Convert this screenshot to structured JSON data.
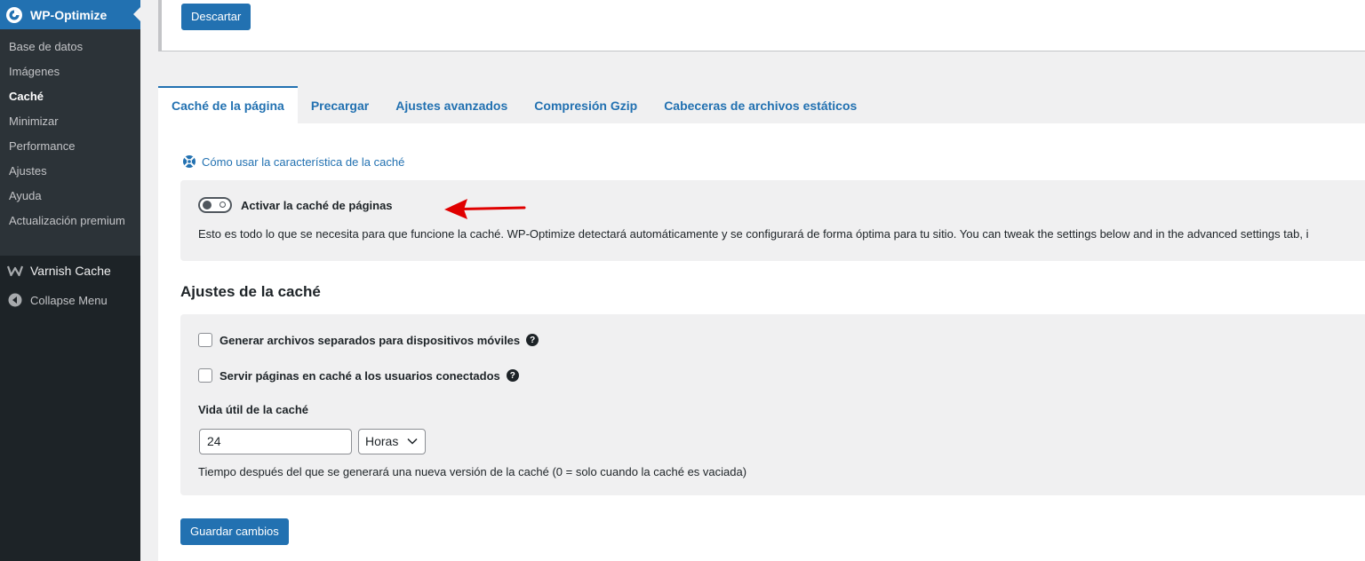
{
  "sidebar": {
    "plugin_title": "WP-Optimize",
    "items": [
      {
        "label": "Base de datos",
        "current": false
      },
      {
        "label": "Imágenes",
        "current": false
      },
      {
        "label": "Caché",
        "current": true
      },
      {
        "label": "Minimizar",
        "current": false
      },
      {
        "label": "Performance",
        "current": false
      },
      {
        "label": "Ajustes",
        "current": false
      },
      {
        "label": "Ayuda",
        "current": false
      },
      {
        "label": "Actualización premium",
        "current": false
      }
    ],
    "varnish_label": "Varnish Cache",
    "collapse_label": "Collapse Menu"
  },
  "top_panel": {
    "dismiss_label": "Descartar"
  },
  "tabs": [
    {
      "label": "Caché de la página",
      "active": true
    },
    {
      "label": "Precargar",
      "active": false
    },
    {
      "label": "Ajustes avanzados",
      "active": false
    },
    {
      "label": "Compresión Gzip",
      "active": false
    },
    {
      "label": "Cabeceras de archivos estáticos",
      "active": false
    }
  ],
  "help_link": "Cómo usar la característica de la caché",
  "page_cache": {
    "toggle_label": "Activar la caché de páginas",
    "toggle_on": false,
    "description": "Esto es todo lo que se necesita para que funcione la caché. WP-Optimize detectará automáticamente y se configurará de forma óptima para tu sitio. You can tweak the settings below and in the advanced settings tab, i"
  },
  "cache_settings": {
    "title": "Ajustes de la caché",
    "mobile_label": "Generar archivos separados para dispositivos móviles",
    "mobile_checked": false,
    "logged_in_label": "Servir páginas en caché a los usuarios conectados",
    "logged_in_checked": false,
    "lifetime_label": "Vida útil de la caché",
    "lifetime_value": "24",
    "lifetime_unit": "Horas",
    "lifetime_description": "Tiempo después del que se generará una nueva versión de la caché (0 = solo cuando la caché es vaciada)"
  },
  "save_label": "Guardar cambios",
  "colors": {
    "accent": "#2271b1",
    "sidebar_bg": "#1d2327",
    "submenu_bg": "#2c3338",
    "annotation_arrow": "#e00000"
  }
}
